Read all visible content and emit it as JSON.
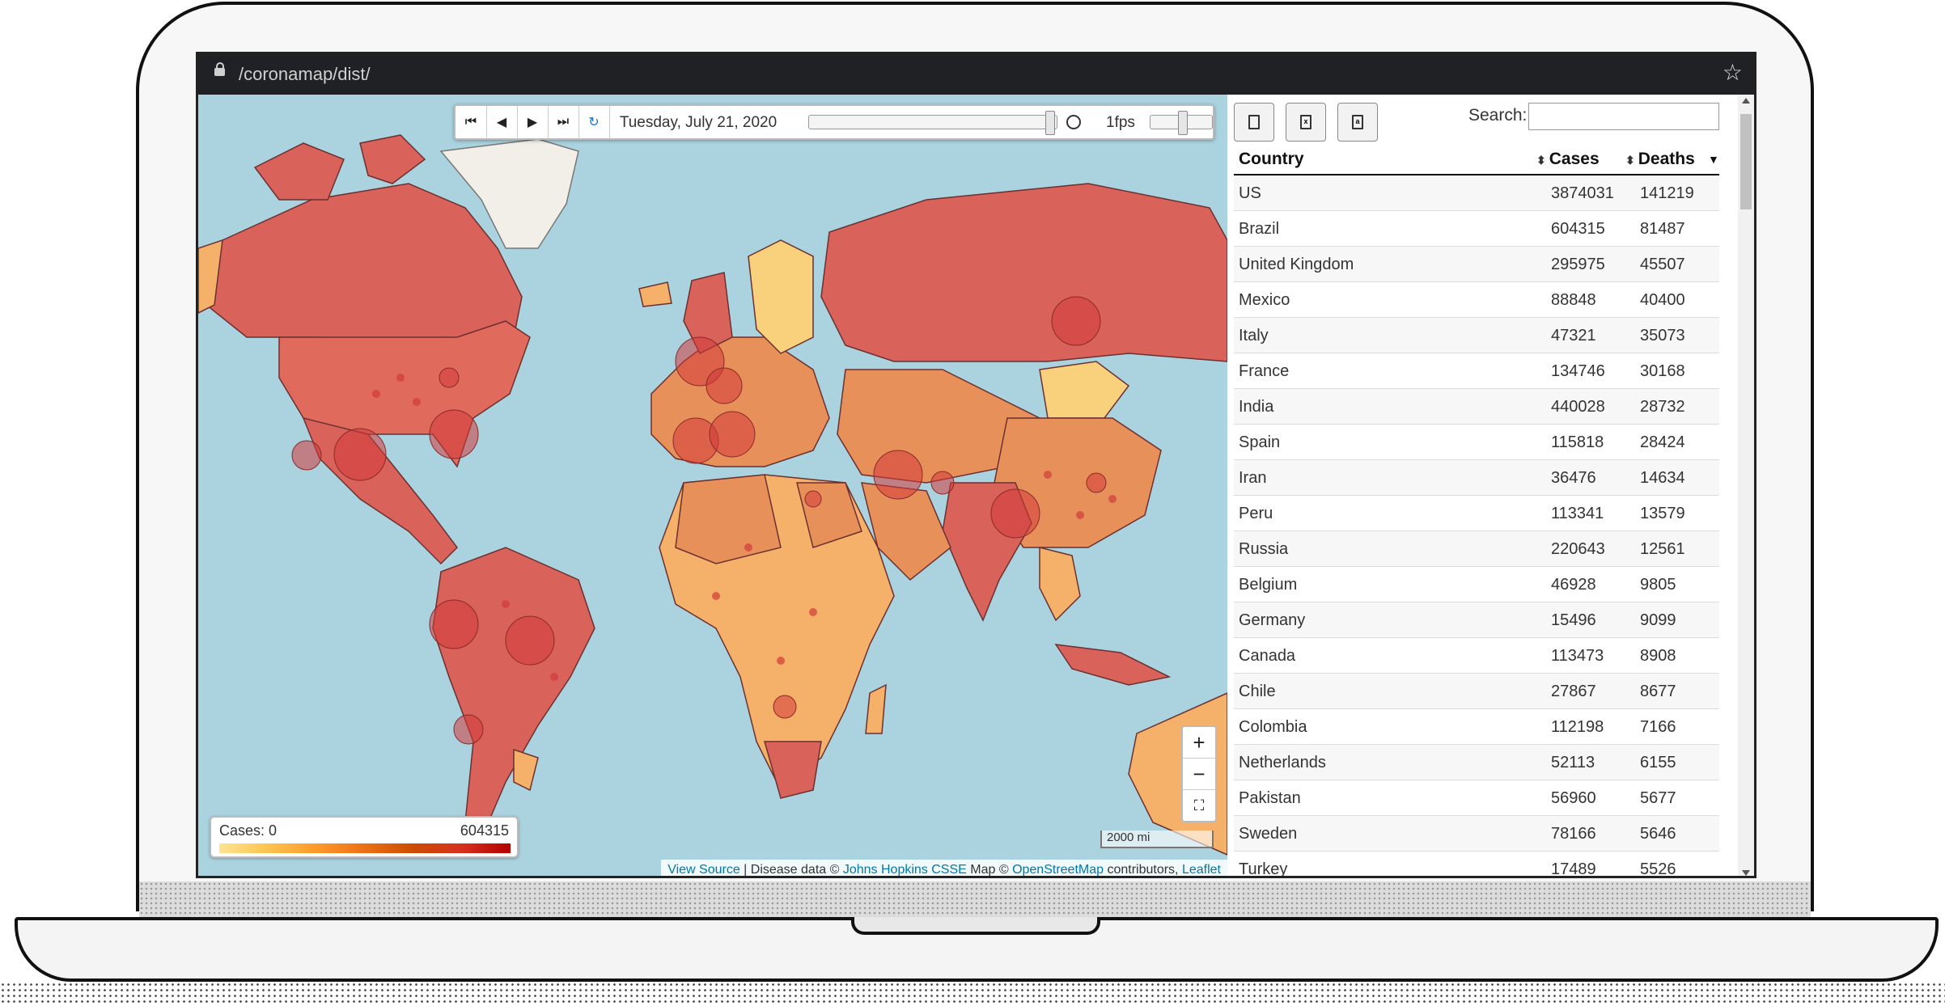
{
  "browser": {
    "url": "/coronamap/dist/"
  },
  "timeline": {
    "date": "Tuesday, July 21, 2020",
    "fps": "1fps",
    "progress": 1.0
  },
  "legend": {
    "min_label": "Cases: 0",
    "max_label": "604315"
  },
  "map": {
    "scale_label": "2000 mi",
    "attribution": {
      "view_source": "View Source",
      "sep1": " | Disease data © ",
      "jhu": "Johns Hopkins CSSE",
      "map_text": " Map © ",
      "osm": "OpenStreetMap",
      "contrib": " contributors, ",
      "leaflet": "Leaflet"
    },
    "colors": {
      "water": "#aad3df",
      "high": "#d9534f",
      "mid": "#e8905a",
      "low": "#f9d17c"
    }
  },
  "search": {
    "label": "Search:",
    "placeholder": ""
  },
  "table": {
    "headers": {
      "country": "Country",
      "cases": "Cases",
      "deaths": "Deaths"
    },
    "rows": [
      {
        "country": "US",
        "cases": "3874031",
        "deaths": "141219"
      },
      {
        "country": "Brazil",
        "cases": "604315",
        "deaths": "81487"
      },
      {
        "country": "United Kingdom",
        "cases": "295975",
        "deaths": "45507"
      },
      {
        "country": "Mexico",
        "cases": "88848",
        "deaths": "40400"
      },
      {
        "country": "Italy",
        "cases": "47321",
        "deaths": "35073"
      },
      {
        "country": "France",
        "cases": "134746",
        "deaths": "30168"
      },
      {
        "country": "India",
        "cases": "440028",
        "deaths": "28732"
      },
      {
        "country": "Spain",
        "cases": "115818",
        "deaths": "28424"
      },
      {
        "country": "Iran",
        "cases": "36476",
        "deaths": "14634"
      },
      {
        "country": "Peru",
        "cases": "113341",
        "deaths": "13579"
      },
      {
        "country": "Russia",
        "cases": "220643",
        "deaths": "12561"
      },
      {
        "country": "Belgium",
        "cases": "46928",
        "deaths": "9805"
      },
      {
        "country": "Germany",
        "cases": "15496",
        "deaths": "9099"
      },
      {
        "country": "Canada",
        "cases": "113473",
        "deaths": "8908"
      },
      {
        "country": "Chile",
        "cases": "27867",
        "deaths": "8677"
      },
      {
        "country": "Colombia",
        "cases": "112198",
        "deaths": "7166"
      },
      {
        "country": "Netherlands",
        "cases": "52113",
        "deaths": "6155"
      },
      {
        "country": "Pakistan",
        "cases": "56960",
        "deaths": "5677"
      },
      {
        "country": "Sweden",
        "cases": "78166",
        "deaths": "5646"
      },
      {
        "country": "Turkey",
        "cases": "17489",
        "deaths": "5526"
      }
    ]
  }
}
